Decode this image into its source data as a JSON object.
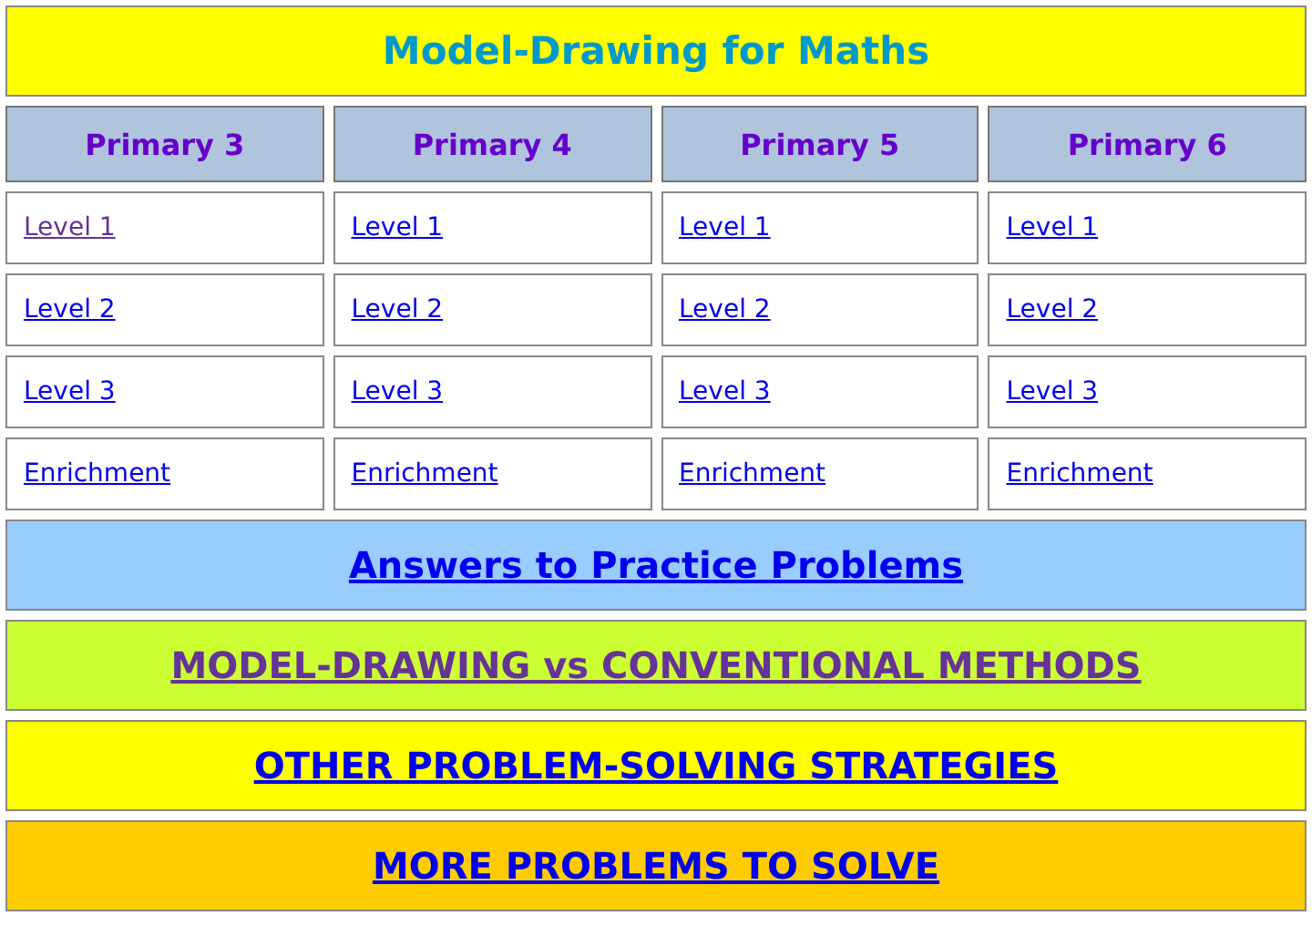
{
  "title": "Model-Drawing for Maths",
  "columns": [
    {
      "heading": "Primary 3",
      "links": [
        {
          "label": "Level 1",
          "visited": true
        },
        {
          "label": "Level 2",
          "visited": false
        },
        {
          "label": "Level 3",
          "visited": false
        },
        {
          "label": "Enrichment",
          "visited": false
        }
      ]
    },
    {
      "heading": "Primary 4",
      "links": [
        {
          "label": "Level 1",
          "visited": false
        },
        {
          "label": "Level 2",
          "visited": false
        },
        {
          "label": "Level 3",
          "visited": false
        },
        {
          "label": "Enrichment",
          "visited": false
        }
      ]
    },
    {
      "heading": "Primary 5",
      "links": [
        {
          "label": "Level 1",
          "visited": false
        },
        {
          "label": "Level 2",
          "visited": false
        },
        {
          "label": "Level 3",
          "visited": false
        },
        {
          "label": "Enrichment",
          "visited": false
        }
      ]
    },
    {
      "heading": "Primary 6",
      "links": [
        {
          "label": "Level 1",
          "visited": false
        },
        {
          "label": "Level 2",
          "visited": false
        },
        {
          "label": "Level 3",
          "visited": false
        },
        {
          "label": "Enrichment",
          "visited": false
        }
      ]
    }
  ],
  "banners": [
    {
      "label": "Answers to Practice Problems",
      "color": "#99ccff",
      "visited": false
    },
    {
      "label": "MODEL-DRAWING vs CONVENTIONAL METHODS",
      "color": "#ccff33",
      "visited": true
    },
    {
      "label": "OTHER PROBLEM-SOLVING STRATEGIES",
      "color": "#ffff00",
      "visited": false
    },
    {
      "label": "MORE PROBLEMS TO SOLVE",
      "color": "#ffcc00",
      "visited": false
    }
  ]
}
